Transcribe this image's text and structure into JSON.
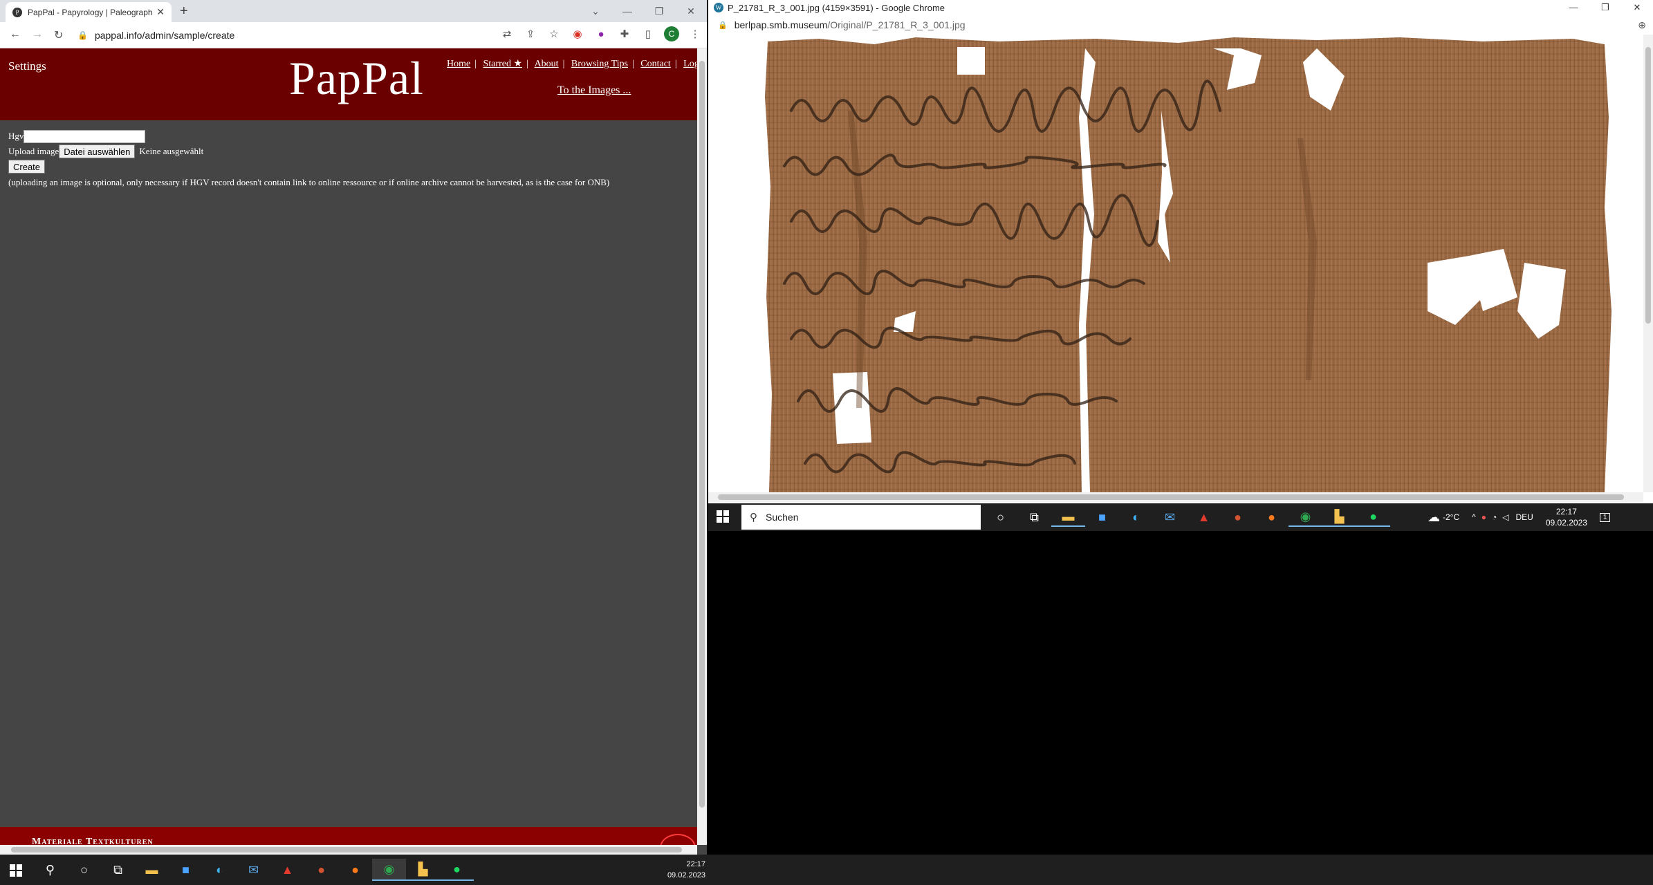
{
  "left_browser": {
    "tab_title": "PapPal - Papyrology | Paleograph",
    "favicon_letter": "P",
    "new_tab_symbol": "+",
    "url": "pappal.info/admin/sample/create",
    "profile_letter": "C"
  },
  "page": {
    "settings_label": "Settings",
    "brand": "PapPal",
    "nav": [
      "Home",
      "Starred ★",
      "About",
      "Browsing Tips",
      "Contact",
      "Logout"
    ],
    "to_images": "To the Images ...",
    "hgv_label": "Hgv",
    "upload_label": "Upload image",
    "file_button": "Datei auswählen",
    "file_status": "Keine ausgewählt",
    "create_button": "Create",
    "note": "(uploading an image is optional, only necessary if HGV record doesn't contain link to online ressource or if online archive cannot be harvested, as is the case for ONB)",
    "footer_text": "Materiale Textkulturen"
  },
  "right_browser": {
    "window_title": "P_21781_R_3_001.jpg (4159×3591) - Google Chrome",
    "favicon_letter": "W",
    "url_host": "berlpap.smb.museum",
    "url_path": "/Original/P_21781_R_3_001.jpg",
    "image_alt": "Papyrus P 21781 recto, Greek cursive script"
  },
  "right_taskbar": {
    "search_placeholder": "Suchen",
    "weather": "-2°C",
    "language": "DEU",
    "time": "22:17",
    "date": "09.02.2023",
    "notification_count": "1"
  },
  "main_taskbar": {
    "time": "22:17",
    "date": "09.02.2023"
  },
  "colors": {
    "header_bg": "#6b0000",
    "footer_bg": "#8b0000",
    "page_bg": "#454545",
    "papyrus": "#9c6b45"
  }
}
